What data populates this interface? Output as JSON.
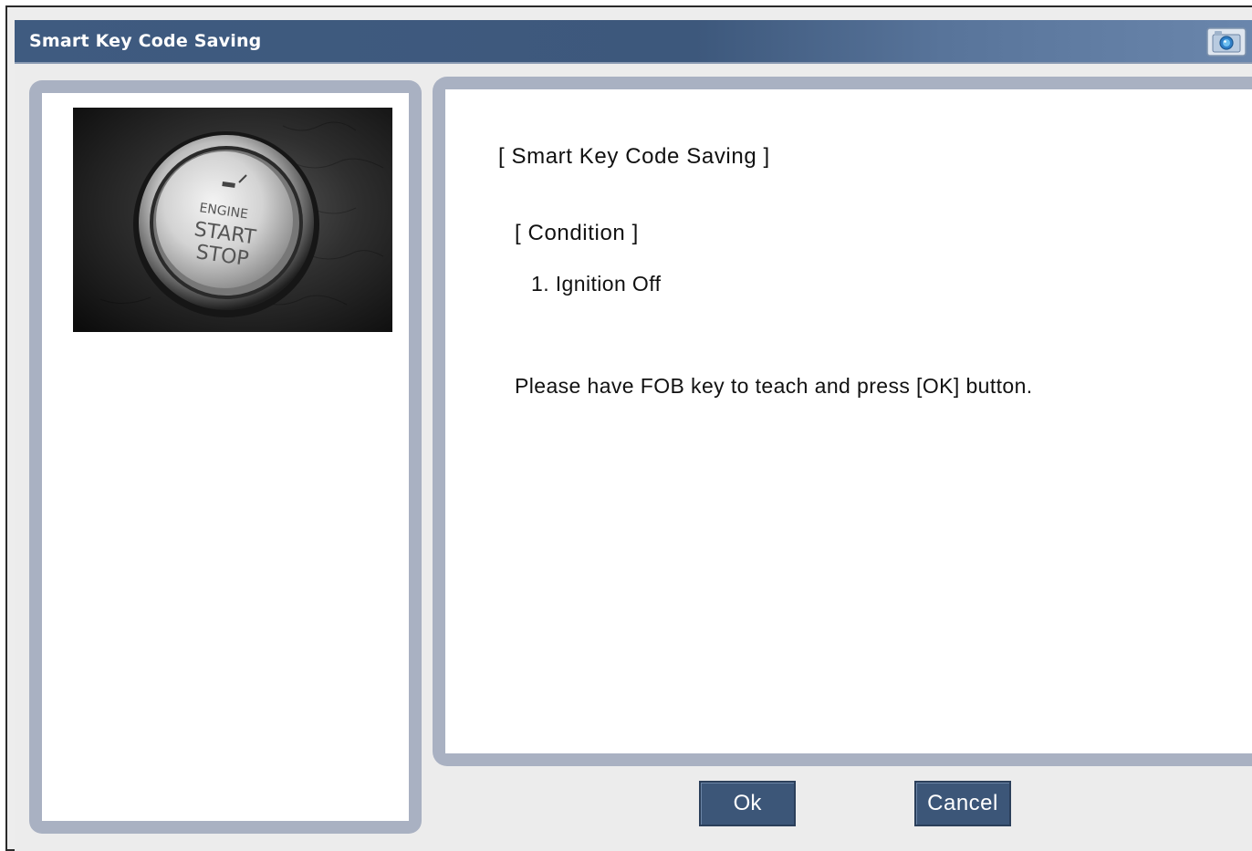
{
  "window": {
    "title": "Smart Key Code Saving",
    "title_bar_color": "#3f5b80",
    "panel_border_color": "#a9b1c2"
  },
  "image_panel": {
    "photo_text": [
      "ENGINE",
      "START",
      "STOP"
    ],
    "icon": "engine-start-stop-button-photo"
  },
  "message": {
    "heading": "[ Smart Key Code Saving ]",
    "condition_label": "[ Condition ]",
    "condition_item": "1. Ignition Off",
    "instruction": "Please have FOB key to teach and press [OK] button."
  },
  "buttons": {
    "ok_label": "Ok",
    "cancel_label": "Cancel",
    "color": "#3c5678"
  },
  "toolbar": {
    "capture_icon": "camera-icon"
  }
}
